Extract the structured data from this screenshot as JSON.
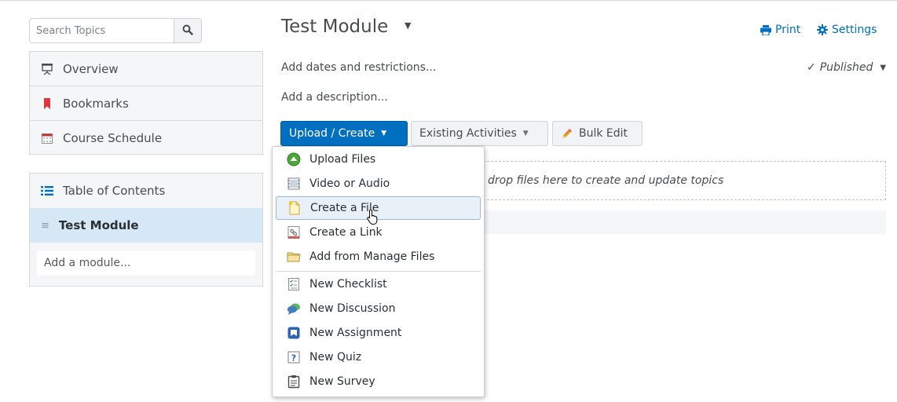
{
  "sidebar": {
    "search": {
      "placeholder": "Search Topics"
    },
    "nav": [
      {
        "label": "Overview",
        "icon": "presentation-icon"
      },
      {
        "label": "Bookmarks",
        "icon": "bookmark-icon"
      },
      {
        "label": "Course Schedule",
        "icon": "calendar-icon"
      }
    ],
    "toc": {
      "title": "Table of Contents",
      "modules": [
        {
          "label": "Test Module"
        }
      ],
      "add_module": "Add a module..."
    }
  },
  "main": {
    "title": "Test Module",
    "print": "Print",
    "settings": "Settings",
    "add_dates": "Add dates and restrictions...",
    "status": "Published",
    "add_description": "Add a description...",
    "buttons": {
      "upload_create": "Upload / Create",
      "existing": "Existing Activities",
      "bulk_edit": "Bulk Edit"
    },
    "dropzone": "drop files here to create and update topics"
  },
  "menu": {
    "items": [
      {
        "label": "Upload Files",
        "icon": "upload-icon"
      },
      {
        "label": "Video or Audio",
        "icon": "video-icon"
      },
      {
        "label": "Create a File",
        "icon": "new-file-icon"
      },
      {
        "label": "Create a Link",
        "icon": "link-icon"
      },
      {
        "label": "Add from Manage Files",
        "icon": "folder-icon"
      },
      {
        "label": "New Checklist",
        "icon": "checklist-icon"
      },
      {
        "label": "New Discussion",
        "icon": "discussion-icon"
      },
      {
        "label": "New Assignment",
        "icon": "assignment-icon"
      },
      {
        "label": "New Quiz",
        "icon": "quiz-icon"
      },
      {
        "label": "New Survey",
        "icon": "survey-icon"
      }
    ],
    "highlighted": "Create a File"
  },
  "colors": {
    "accent": "#006fbf",
    "selected_module_bg": "#d6e8f6",
    "sidebar_bg": "#f5f6f7"
  }
}
